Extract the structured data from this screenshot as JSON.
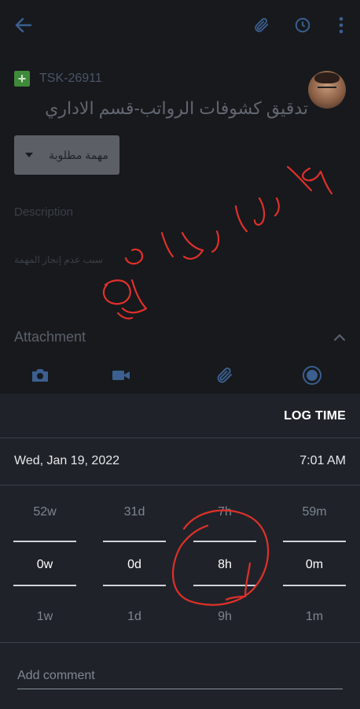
{
  "header": {
    "back_icon": "arrow-left-icon",
    "attach_icon": "paperclip-icon",
    "history_icon": "clock-icon",
    "more_icon": "more-vertical-icon"
  },
  "task": {
    "key": "TSK-26911",
    "title": "تدقيق كشوفات الرواتب-قسم الاداري",
    "status": "مهمة مطلوبة",
    "description_label": "Description",
    "description_value": "سبب عدم إنجاز المهمة",
    "attachment_label": "Attachment",
    "attachment_icons": [
      "camera-icon",
      "video-icon",
      "paperclip-icon",
      "record-icon"
    ]
  },
  "log_time": {
    "title": "LOG TIME",
    "date": "Wed, Jan 19, 2022",
    "time": "7:01 AM",
    "columns": [
      {
        "prev": "52w",
        "current": "0w",
        "next": "1w"
      },
      {
        "prev": "31d",
        "current": "0d",
        "next": "1d"
      },
      {
        "prev": "7h",
        "current": "8h",
        "next": "9h"
      },
      {
        "prev": "59m",
        "current": "0m",
        "next": "1m"
      }
    ],
    "comment_placeholder": "Add comment"
  },
  "colors": {
    "accent": "#3b5f8f",
    "sheet_bg": "#1f2329",
    "annotation": "#e0302a"
  }
}
